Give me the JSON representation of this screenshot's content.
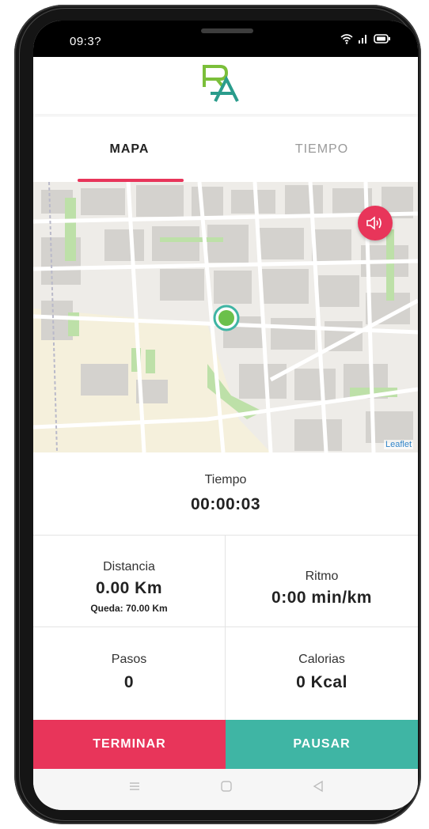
{
  "status_bar": {
    "time": "09:3?",
    "icons": [
      "wifi-icon",
      "signal-icon",
      "battery-icon"
    ]
  },
  "header": {
    "logo": "RA logo"
  },
  "tabs": [
    {
      "label": "MAPA",
      "active": true
    },
    {
      "label": "TIEMPO",
      "active": false
    }
  ],
  "map": {
    "attribution": "Leaflet",
    "sound_icon": "speaker-icon"
  },
  "stats": {
    "tiempo": {
      "label": "Tiempo",
      "value": "00:00:03"
    },
    "distancia": {
      "label": "Distancia",
      "value": "0.00 Km",
      "sub": "Queda: 70.00 Km"
    },
    "ritmo": {
      "label": "Ritmo",
      "value": "0:00 min/km"
    },
    "pasos": {
      "label": "Pasos",
      "value": "0"
    },
    "calorias": {
      "label": "Calorias",
      "value": "0 Kcal"
    }
  },
  "actions": {
    "terminar": "TERMINAR",
    "pausar": "PAUSAR"
  },
  "nav_bar": {
    "icons": [
      "menu-icon",
      "home-icon",
      "back-icon"
    ]
  },
  "colors": {
    "primary": "#e8355a",
    "secondary": "#3fb5a4"
  }
}
